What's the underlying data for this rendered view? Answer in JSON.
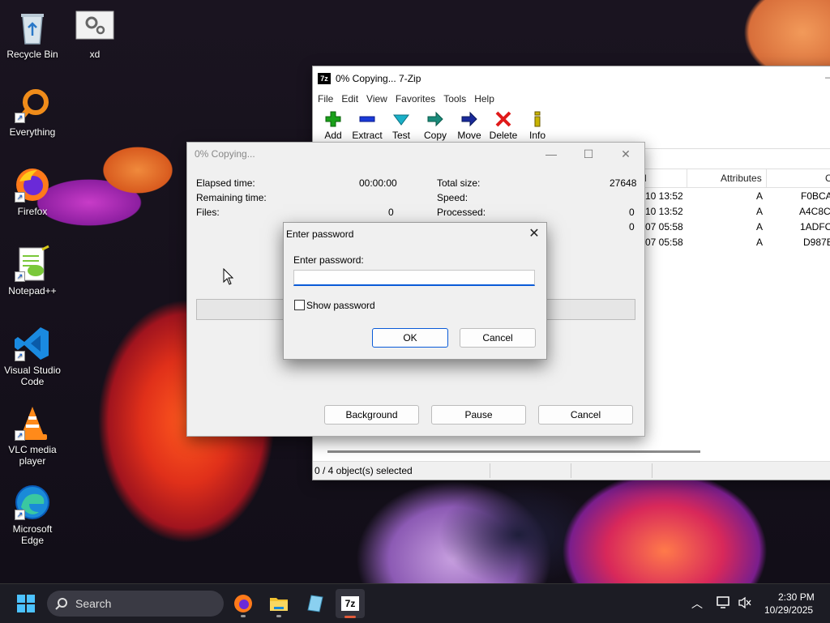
{
  "desktop": {
    "icons": [
      {
        "label": "Recycle Bin",
        "icon": "recycle-bin-icon"
      },
      {
        "label": "xd",
        "icon": "settings-file-icon"
      },
      {
        "label": "Everything",
        "icon": "everything-search-icon"
      },
      {
        "label": "Firefox",
        "icon": "firefox-icon"
      },
      {
        "label": "Notepad++",
        "icon": "notepadpp-icon"
      },
      {
        "label": "Visual Studio Code",
        "icon": "vscode-icon"
      },
      {
        "label": "VLC media player",
        "icon": "vlc-icon"
      },
      {
        "label": "Microsoft Edge",
        "icon": "edge-icon"
      }
    ]
  },
  "zip_window": {
    "title": "0% Copying... 7-Zip",
    "app_icon_text": "7z",
    "menu": [
      "File",
      "Edit",
      "View",
      "Favorites",
      "Tools",
      "Help"
    ],
    "toolbar": [
      {
        "label": "Add",
        "icon": "plus-icon",
        "color": "#1aa01a"
      },
      {
        "label": "Extract",
        "icon": "minus-icon",
        "color": "#1a3ad8"
      },
      {
        "label": "Test",
        "icon": "check-arrow-icon",
        "color": "#1ab0c8"
      },
      {
        "label": "Copy",
        "icon": "arrow-right-icon",
        "color": "#1a8a7a"
      },
      {
        "label": "Move",
        "icon": "arrow-right-icon",
        "color": "#1a2a9a"
      },
      {
        "label": "Delete",
        "icon": "x-icon",
        "color": "#e01a1a"
      },
      {
        "label": "Info",
        "icon": "info-icon",
        "color": "#c8b400"
      }
    ],
    "columns": [
      "d",
      "Attributes",
      "C"
    ],
    "rows": [
      {
        "modified": "-10 13:52",
        "attributes": "A",
        "crc": "F0BCA"
      },
      {
        "modified": "-10 13:52",
        "attributes": "A",
        "crc": "A4C8C"
      },
      {
        "modified": "-07 05:58",
        "attributes": "A",
        "crc": "1ADFC"
      },
      {
        "modified": "-07 05:58",
        "attributes": "A",
        "crc": "D987E"
      }
    ],
    "status": "0 / 4 object(s) selected"
  },
  "copy_dialog": {
    "title": "0% Copying...",
    "elapsed_label": "Elapsed time:",
    "elapsed_value": "00:00:00",
    "remaining_label": "Remaining time:",
    "files_label": "Files:",
    "files_value": "0",
    "total_size_label": "Total size:",
    "total_size_value": "27648",
    "speed_label": "Speed:",
    "processed_label": "Processed:",
    "processed_value": "0",
    "extra_value": "0",
    "buttons": {
      "background": "Background",
      "pause": "Pause",
      "cancel": "Cancel"
    }
  },
  "password_dialog": {
    "title": "Enter password",
    "prompt": "Enter password:",
    "input_value": "",
    "show_password_label": "Show password",
    "show_password_checked": false,
    "ok": "OK",
    "cancel": "Cancel"
  },
  "taskbar": {
    "search_placeholder": "Search",
    "time": "2:30 PM",
    "date": "10/29/2025",
    "apps": [
      "firefox-icon",
      "file-explorer-icon",
      "notepad-icon",
      "7zip-icon"
    ]
  }
}
